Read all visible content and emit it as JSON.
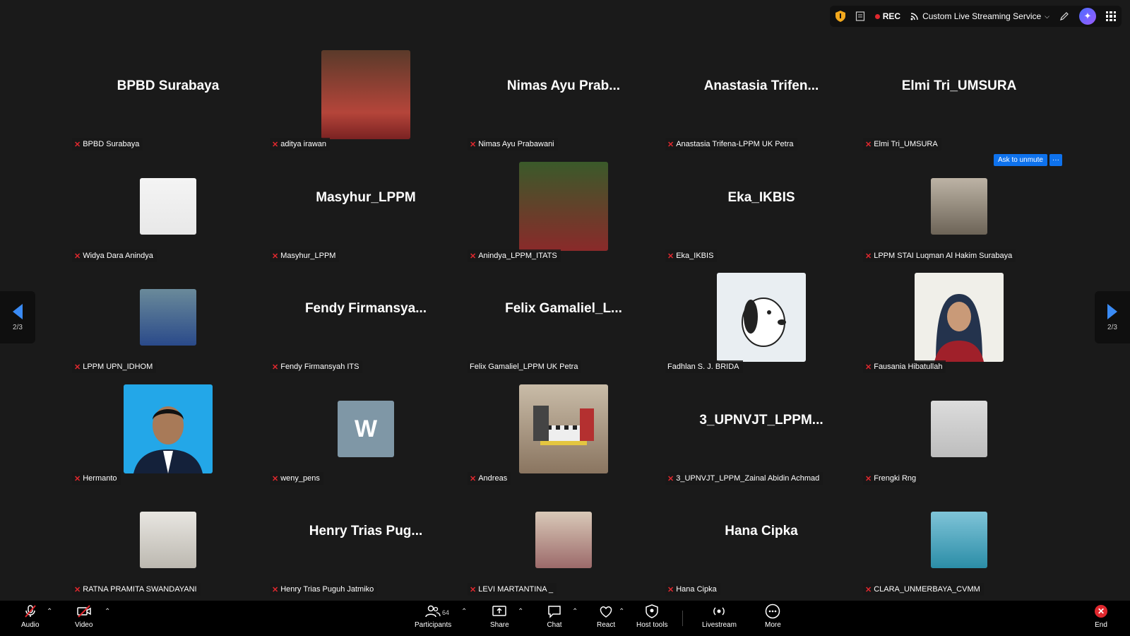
{
  "topbar": {
    "rec_label": "REC",
    "stream_label": "Custom Live Streaming Service",
    "ai_icon": "sparkle-icon"
  },
  "pager": {
    "left": "2/3",
    "right": "2/3"
  },
  "ask_to_unmute": {
    "label": "Ask to unmute",
    "more": "···"
  },
  "tiles": [
    {
      "title": "BPBD Surabaya",
      "label": "BPBD Surabaya"
    },
    {
      "title": "",
      "label": "aditya irawan"
    },
    {
      "title": "Nimas Ayu Prab...",
      "label": "Nimas Ayu Prabawani"
    },
    {
      "title": "Anastasia  Trifen...",
      "label": "Anastasia Trifena-LPPM UK Petra"
    },
    {
      "title": "Elmi Tri_UMSURA",
      "label": "Elmi Tri_UMSURA"
    },
    {
      "title": "",
      "label": "Widya Dara Anindya"
    },
    {
      "title": "Masyhur_LPPM",
      "label": "Masyhur_LPPM"
    },
    {
      "title": "",
      "label": "Anindya_LPPM_ITATS"
    },
    {
      "title": "Eka_IKBIS",
      "label": "Eka_IKBIS"
    },
    {
      "title": "",
      "label": "LPPM STAI Luqman Al Hakim Surabaya"
    },
    {
      "title": "",
      "label": "LPPM UPN_IDHOM"
    },
    {
      "title": "Fendy  Firmansya...",
      "label": "Fendy Firmansyah ITS"
    },
    {
      "title": "Felix  Gamaliel_L...",
      "label": "Felix Gamaliel_LPPM UK Petra"
    },
    {
      "title": "",
      "label": "Fadhlan S. J. BRIDA"
    },
    {
      "title": "",
      "label": "Fausania Hibatullah"
    },
    {
      "title": "",
      "label": "Hermanto"
    },
    {
      "title": "",
      "label": "weny_pens",
      "initial": "W"
    },
    {
      "title": "",
      "label": "Andreas"
    },
    {
      "title": "3_UPNVJT_LPPM...",
      "label": "3_UPNVJT_LPPM_Zainal Abidin Achmad"
    },
    {
      "title": "",
      "label": "Frengki Rng"
    },
    {
      "title": "",
      "label": "RATNA PRAMITA SWANDAYANI"
    },
    {
      "title": "Henry Trias Pug...",
      "label": "Henry Trias Puguh Jatmiko"
    },
    {
      "title": "",
      "label": "LEVI MARTANTINA _"
    },
    {
      "title": "Hana Cipka",
      "label": "Hana Cipka"
    },
    {
      "title": "",
      "label": "CLARA_UNMERBAYA_CVMM"
    }
  ],
  "toolbar": {
    "audio": "Audio",
    "video": "Video",
    "participants": "Participants",
    "participants_count": "64",
    "share": "Share",
    "chat": "Chat",
    "react": "React",
    "host_tools": "Host tools",
    "livestream": "Livestream",
    "more": "More",
    "end": "End"
  }
}
